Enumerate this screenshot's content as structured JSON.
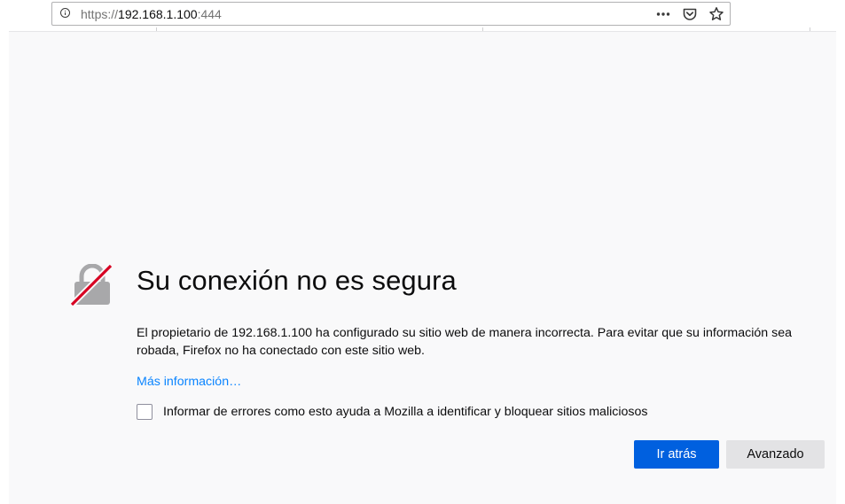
{
  "browser": {
    "url": {
      "scheme": "https://",
      "host": "192.168.1.100",
      "port": ":444"
    },
    "icons": [
      "site-info-icon",
      "page-actions-icon",
      "pocket-icon",
      "bookmark-star-icon"
    ]
  },
  "error_page": {
    "icon": "broken-lock-icon",
    "title": "Su conexión no es segura",
    "description": "El propietario de 192.168.1.100 ha configurado su sitio web de manera incorrecta. Para evitar que su información sea robada, Firefox no ha conectado con este sitio web.",
    "learn_more": "Más información…",
    "report_label": "Informar de errores como esto ayuda a Mozilla a identificar y bloquear sitios maliciosos",
    "report_checked": false,
    "buttons": {
      "back": "Ir atrás",
      "advanced": "Avanzado"
    }
  },
  "colors": {
    "primary_button": "#0060df",
    "link": "#0a84ff",
    "lock_slash": "#d70022",
    "page_background": "#f9f9fa"
  }
}
